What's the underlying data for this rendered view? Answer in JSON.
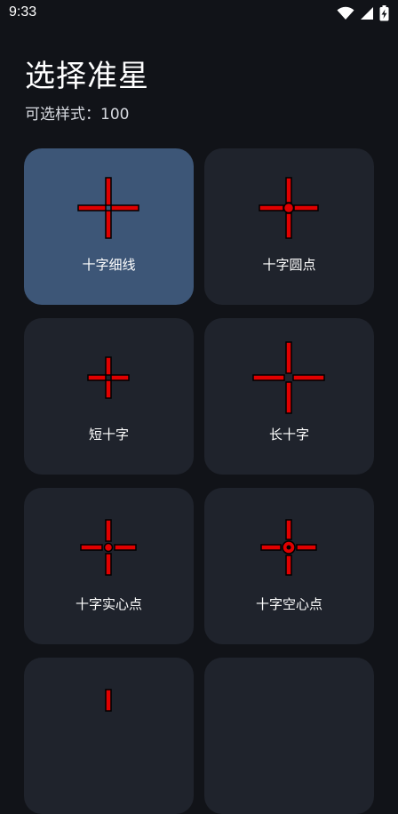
{
  "status_bar": {
    "time": "9:33",
    "icons": [
      "wifi-icon",
      "signal-icon",
      "battery-charging-icon"
    ]
  },
  "page": {
    "title": "选择准星",
    "subtitle": "可选样式：100"
  },
  "colors": {
    "background": "#111318",
    "card": "#1f232c",
    "card_selected": "#3d5677",
    "crosshair_fill": "#e00000",
    "crosshair_outline": "#000000"
  },
  "crosshairs": [
    {
      "label": "十字细线",
      "selected": true,
      "icon": "crosshair-thin-lines-icon"
    },
    {
      "label": "十字圆点",
      "selected": false,
      "icon": "crosshair-round-dot-icon"
    },
    {
      "label": "短十字",
      "selected": false,
      "icon": "crosshair-short-cross-icon"
    },
    {
      "label": "长十字",
      "selected": false,
      "icon": "crosshair-long-cross-icon"
    },
    {
      "label": "十字实心点",
      "selected": false,
      "icon": "crosshair-solid-dot-icon"
    },
    {
      "label": "十字空心点",
      "selected": false,
      "icon": "crosshair-hollow-dot-icon"
    },
    {
      "label": "",
      "selected": false,
      "icon": "crosshair-partial-icon"
    },
    {
      "label": "",
      "selected": false,
      "icon": ""
    }
  ]
}
